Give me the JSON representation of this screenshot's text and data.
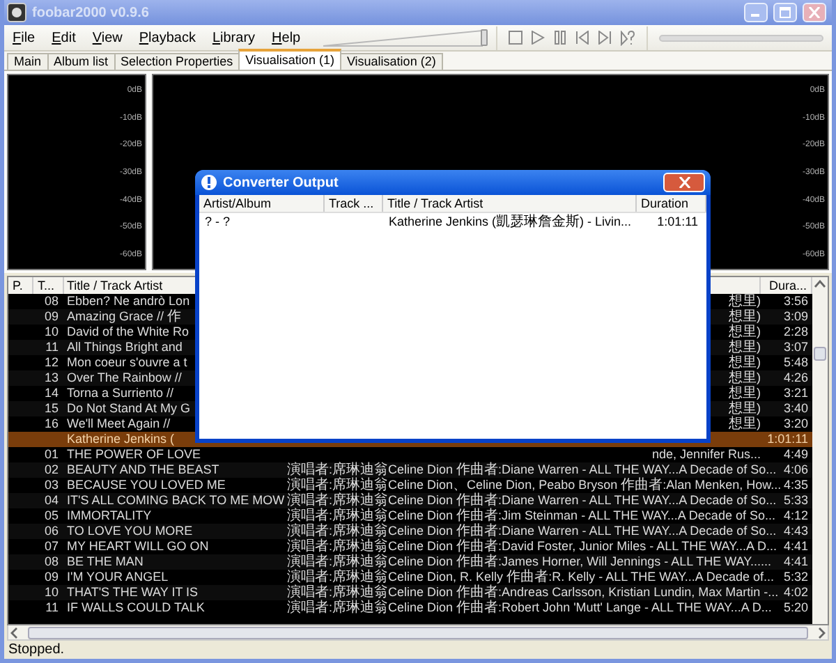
{
  "window": {
    "title": "foobar2000 v0.9.6"
  },
  "menu": [
    "File",
    "Edit",
    "View",
    "Playback",
    "Library",
    "Help"
  ],
  "volume": {
    "level": 1
  },
  "tabs": [
    {
      "label": "Main",
      "selected": false
    },
    {
      "label": "Album list",
      "selected": false
    },
    {
      "label": "Selection Properties",
      "selected": false
    },
    {
      "label": "Visualisation (1)",
      "selected": true
    },
    {
      "label": "Visualisation (2)",
      "selected": false
    }
  ],
  "visualisations": [
    {
      "db_labels": [
        "0dB",
        "-10dB",
        "-20dB",
        "-30dB",
        "-40dB",
        "-50dB",
        "-60dB"
      ]
    },
    {
      "db_labels": [
        "0dB",
        "-10dB",
        "-20dB",
        "-30dB",
        "-40dB",
        "-50dB",
        "-60dB"
      ]
    }
  ],
  "playlist": {
    "columns": {
      "playing": "P.",
      "track": "T...",
      "title": "Title / Track Artist",
      "duration": "Dura..."
    },
    "rows": [
      {
        "track": "08",
        "title": "Ebben? Ne andrò Lon",
        "artist": "想里)",
        "kind": "tail",
        "duration": "3:56",
        "selected": false
      },
      {
        "track": "09",
        "title": "Amazing Grace // 作",
        "artist": "想里)",
        "kind": "tail",
        "duration": "3:09",
        "selected": false
      },
      {
        "track": "10",
        "title": "David of the White Ro",
        "artist": "想里)",
        "kind": "tail",
        "duration": "2:28",
        "selected": false
      },
      {
        "track": "11",
        "title": "All Things Bright and",
        "artist": "想里)",
        "kind": "tail",
        "duration": "3:07",
        "selected": false
      },
      {
        "track": "12",
        "title": "Mon coeur s'ouvre a t",
        "artist": "想里)",
        "kind": "tail",
        "duration": "5:48",
        "selected": false
      },
      {
        "track": "13",
        "title": "Over The Rainbow //",
        "artist": "想里)",
        "kind": "tail",
        "duration": "4:26",
        "selected": false
      },
      {
        "track": "14",
        "title": "Torna a Surriento //",
        "artist": "想里)",
        "kind": "tail",
        "duration": "3:21",
        "selected": false
      },
      {
        "track": "15",
        "title": "Do Not Stand At My G",
        "artist": "想里)",
        "kind": "tail",
        "duration": "3:40",
        "selected": false
      },
      {
        "track": "16",
        "title": "We'll Meet Again //",
        "artist": "想里)",
        "kind": "tail",
        "duration": "3:20",
        "selected": false
      },
      {
        "title": "Katherine Jenkins (",
        "duration": "1:01:11",
        "selected": true
      },
      {
        "track": "01",
        "title": "THE POWER OF LOVE",
        "artist": "nde, Jennifer Rus...",
        "kind": "tail",
        "duration": "4:49",
        "selected": false
      },
      {
        "track": "02",
        "title": "BEAUTY AND THE BEAST",
        "artist": "演唱者:席琳迪翁Celine Dion 作曲者:Diane Warren - ALL THE WAY...A Decade of So...",
        "kind": "full",
        "duration": "4:06",
        "selected": false
      },
      {
        "track": "03",
        "title": "BECAUSE YOU LOVED ME",
        "artist": "演唱者:席琳迪翁Celine Dion、Celine Dion, Peabo Bryson 作曲者:Alan Menken, How...",
        "kind": "full",
        "duration": "4:35",
        "selected": false
      },
      {
        "track": "04",
        "title": "IT'S ALL COMING BACK TO ME MOW",
        "artist": "演唱者:席琳迪翁Celine Dion 作曲者:Diane Warren - ALL THE WAY...A Decade of So...",
        "kind": "full",
        "duration": "5:33",
        "selected": false
      },
      {
        "track": "05",
        "title": "IMMORTALITY",
        "artist": "演唱者:席琳迪翁Celine Dion 作曲者:Jim Steinman - ALL THE WAY...A Decade of So...",
        "kind": "full",
        "duration": "4:12",
        "selected": false
      },
      {
        "track": "06",
        "title": "TO LOVE YOU MORE",
        "artist": "演唱者:席琳迪翁Celine Dion 作曲者:Diane Warren - ALL THE WAY...A Decade of So...",
        "kind": "full",
        "duration": "4:43",
        "selected": false
      },
      {
        "track": "07",
        "title": "MY HEART WILL GO ON",
        "artist": "演唱者:席琳迪翁Celine Dion 作曲者:David Foster, Junior Miles - ALL THE WAY...A D...",
        "kind": "full",
        "duration": "4:41",
        "selected": false
      },
      {
        "track": "08",
        "title": "BE THE MAN",
        "artist": "演唱者:席琳迪翁Celine Dion 作曲者:James Horner, Will Jennings - ALL THE WAY......",
        "kind": "full",
        "duration": "4:41",
        "selected": false
      },
      {
        "track": "09",
        "title": "I'M YOUR ANGEL",
        "artist": "演唱者:席琳迪翁Celine Dion, R. Kelly 作曲者:R. Kelly - ALL THE WAY...A Decade of...",
        "kind": "full",
        "duration": "5:32",
        "selected": false
      },
      {
        "track": "10",
        "title": "THAT'S THE  WAY IT IS",
        "artist": "演唱者:席琳迪翁Celine Dion 作曲者:Andreas Carlsson, Kristian Lundin, Max Martin -...",
        "kind": "full",
        "duration": "4:02",
        "selected": false
      },
      {
        "track": "11",
        "title": "IF WALLS COULD TALK",
        "artist": "演唱者:席琳迪翁Celine Dion 作曲者:Robert John 'Mutt' Lange - ALL THE WAY...A D...",
        "kind": "full",
        "duration": "5:20",
        "selected": false
      }
    ]
  },
  "dialog": {
    "title": "Converter Output",
    "columns": [
      "Artist/Album",
      "Track ...",
      "Title / Track Artist",
      "Duration"
    ],
    "rows": [
      {
        "artist_album": "? - ?",
        "title": "Katherine Jenkins (凱瑟琳詹金斯) - Livin...",
        "duration": "1:01:11"
      }
    ]
  },
  "status_bar": "Stopped."
}
